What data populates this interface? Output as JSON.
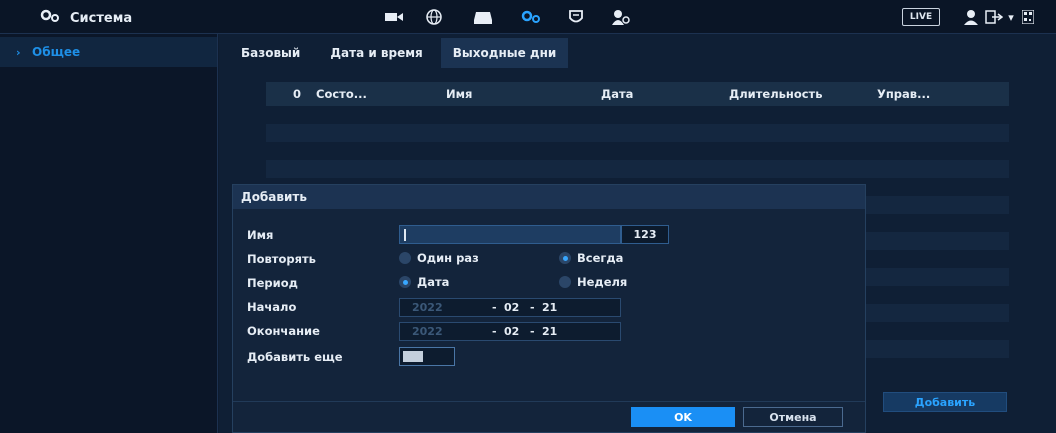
{
  "topbar": {
    "title": "Система",
    "icons": [
      "camera-icon",
      "network-icon",
      "storage-icon",
      "settings-icon",
      "security-icon",
      "account-icon"
    ],
    "live_label": "LIVE",
    "user_icon": "user-icon",
    "logout_icon": "logout-icon"
  },
  "sidebar": {
    "items": [
      {
        "label": "Общее"
      }
    ]
  },
  "tabs": [
    {
      "label": "Базовый"
    },
    {
      "label": "Дата и время"
    },
    {
      "label": "Выходные дни"
    }
  ],
  "table": {
    "columns": [
      "0",
      "Состо...",
      "Имя",
      "Дата",
      "Длительность",
      "Управ..."
    ],
    "rows": []
  },
  "add_button_label": "Добавить",
  "dialog": {
    "title": "Добавить",
    "name_label": "Имя",
    "name_value": "",
    "name_suffix": "123",
    "repeat_label": "Повторять",
    "repeat_options": [
      "Один раз",
      "Всегда"
    ],
    "repeat_selected": "Всегда",
    "period_label": "Период",
    "period_options": [
      "Дата",
      "Неделя"
    ],
    "period_selected": "Дата",
    "start_label": "Начало",
    "start": {
      "year": "2022",
      "month": "02",
      "day": "21"
    },
    "end_label": "Окончание",
    "end": {
      "year": "2022",
      "month": "02",
      "day": "21"
    },
    "add_more_label": "Добавить еще",
    "ok_label": "OK",
    "cancel_label": "Отмена"
  },
  "colors": {
    "accent": "#1a8ff5",
    "background": "#0e1c30",
    "panel": "#13243b"
  }
}
